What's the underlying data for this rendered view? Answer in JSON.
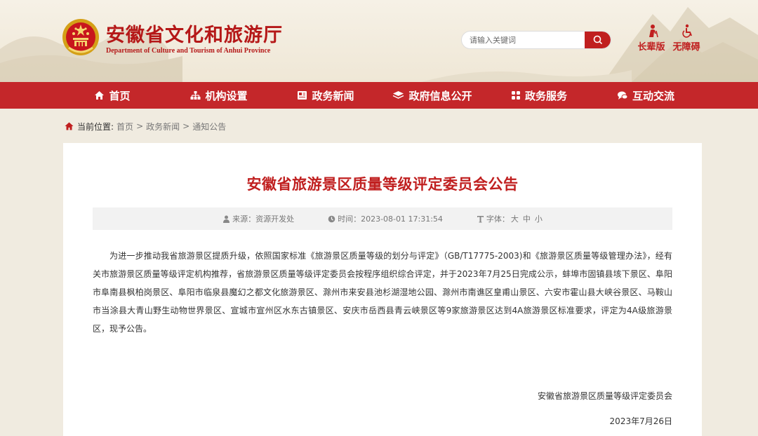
{
  "header": {
    "title": "安徽省文化和旅游厅",
    "subtitle": "Department of Culture and Tourism of Anhui Province",
    "search_placeholder": "请输入关键词",
    "elder_mode_label": "长辈版",
    "accessibility_label": "无障碍"
  },
  "nav": {
    "items": [
      {
        "label": "首页",
        "icon": "home-icon"
      },
      {
        "label": "机构设置",
        "icon": "sitemap-icon"
      },
      {
        "label": "政务新闻",
        "icon": "newspaper-icon"
      },
      {
        "label": "政府信息公开",
        "icon": "layers-icon"
      },
      {
        "label": "政务服务",
        "icon": "grid-icon"
      },
      {
        "label": "互动交流",
        "icon": "chat-icon"
      }
    ]
  },
  "breadcrumb": {
    "label": "当前位置:",
    "items": [
      "首页",
      "政务新闻",
      "通知公告"
    ],
    "separator": ">"
  },
  "article": {
    "title": "安徽省旅游景区质量等级评定委员会公告",
    "meta": {
      "source_label": "来源：",
      "source": "资源开发处",
      "time_label": "时间：",
      "time": "2023-08-01 17:31:54",
      "font_label": "字体：",
      "font_sizes": [
        "大",
        "中",
        "小"
      ]
    },
    "body": "为进一步推动我省旅游景区提质升级，依照国家标准《旅游景区质量等级的划分与评定》（GB/T17775-2003)和《旅游景区质量等级管理办法》，经有关市旅游景区质量等级评定机构推荐，省旅游景区质量等级评定委员会按程序组织综合评定，并于2023年7月25日完成公示，蚌埠市固镇县垓下景区、阜阳市阜南县枫柏岗景区、阜阳市临泉县魔幻之都文化旅游景区、滁州市来安县池杉湖湿地公园、滁州市南谯区皇甫山景区、六安市霍山县大峡谷景区、马鞍山市当涂县大青山野生动物世界景区、宣城市宣州区水东古镇景区、安庆市岳西县青云峡景区等9家旅游景区达到4A旅游景区标准要求，评定为4A级旅游景区，现予公告。",
    "signature": "安徽省旅游景区质量等级评定委员会",
    "date": "2023年7月26日"
  },
  "colors": {
    "brand_red": "#c4272a",
    "title_red": "#c01f1f",
    "background": "#f0ebe0"
  }
}
